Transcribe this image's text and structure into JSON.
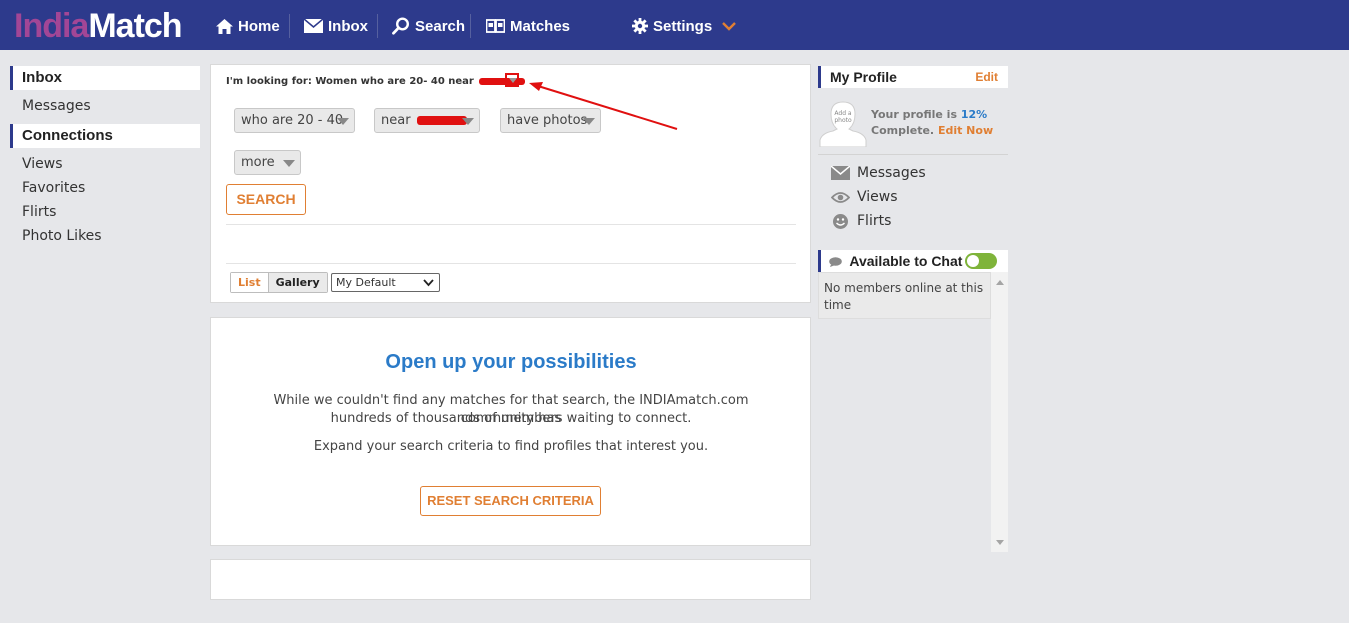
{
  "brand": {
    "part1": "India",
    "part2": "Match",
    "accent_color": "#a24696",
    "bar_color": "#2d3a8c"
  },
  "nav": {
    "home": "Home",
    "inbox": "Inbox",
    "search": "Search",
    "matches": "Matches",
    "settings": "Settings"
  },
  "sidebar": {
    "inbox_head": "Inbox",
    "messages": "Messages",
    "connections_head": "Connections",
    "views": "Views",
    "favorites": "Favorites",
    "flirts": "Flirts",
    "photo_likes": "Photo Likes"
  },
  "search_panel": {
    "looking_for": "I'm looking for: Women who are 20- 40 near",
    "age_select": "who are 20 - 40",
    "near_select": "near",
    "photos_select": "have photos",
    "more_select": "more",
    "search_button": "SEARCH",
    "view_list": "List",
    "view_gallery": "Gallery",
    "sort_select": "My Default"
  },
  "no_results": {
    "title": "Open up your possibilities",
    "line1": "While we couldn't find any matches for that search, the INDIAmatch.com community has",
    "line2": "hundreds of thousands of members waiting to connect.",
    "line3": "Expand your search criteria to find profiles that interest you.",
    "reset_button": "RESET SEARCH CRITERIA"
  },
  "profile": {
    "head": "My Profile",
    "edit": "Edit",
    "avatar_text_1": "Add a",
    "avatar_text_2": "photo",
    "complete_prefix": "Your profile is ",
    "complete_pct": "12%",
    "complete_suffix": "Complete. ",
    "edit_now": "Edit Now",
    "messages": "Messages",
    "views": "Views",
    "flirts": "Flirts"
  },
  "chat": {
    "head": "Available to Chat",
    "enabled": true,
    "empty_line1": "No members online at this",
    "empty_line2": "time"
  }
}
